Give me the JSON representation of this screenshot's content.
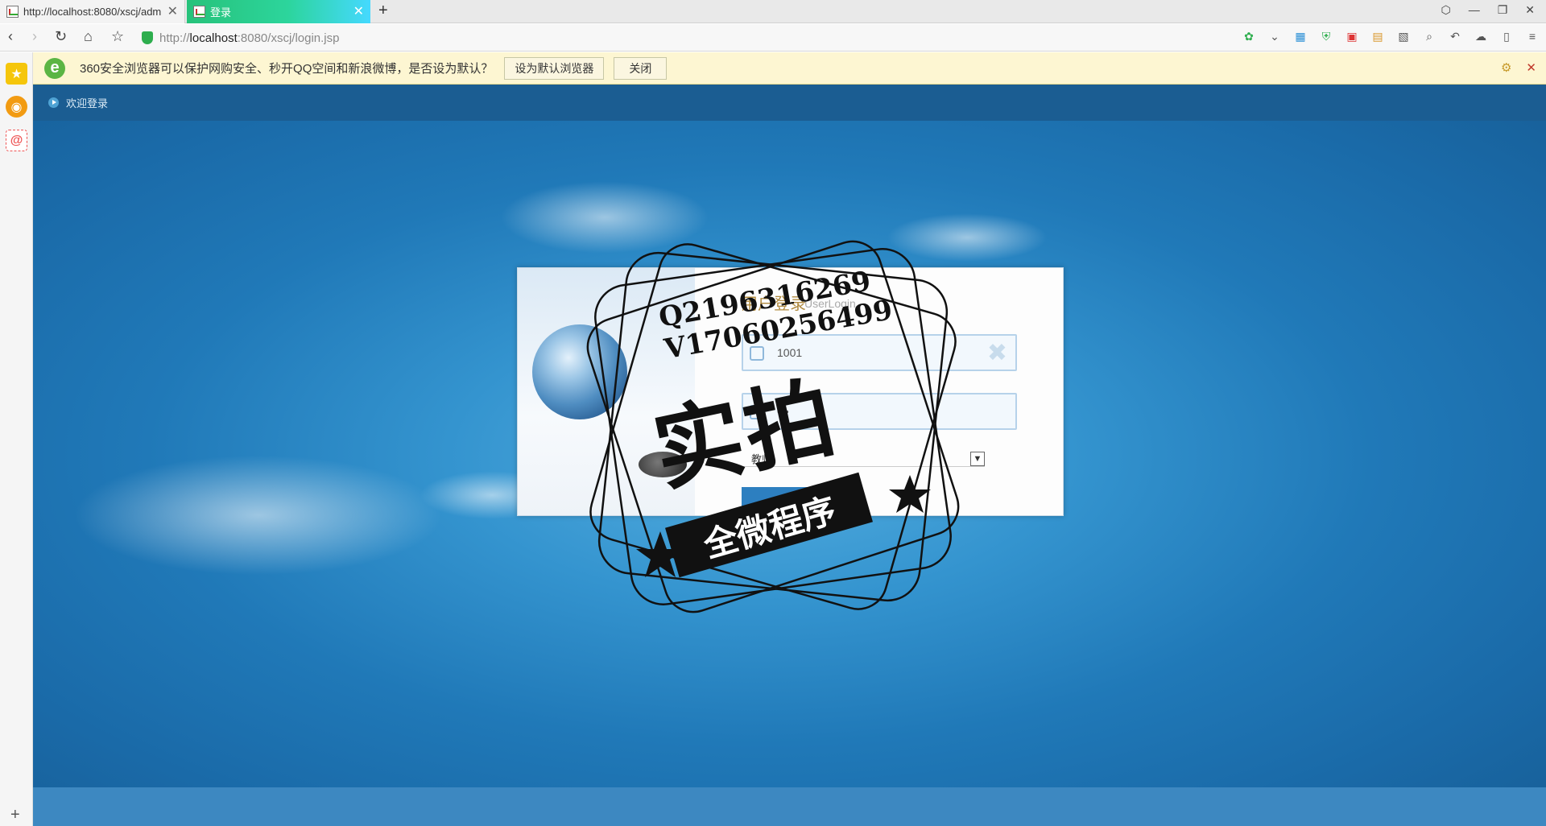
{
  "tabs": [
    {
      "label": "http://localhost:8080/xscj/adm",
      "active": false
    },
    {
      "label": "登录",
      "active": true
    }
  ],
  "address": {
    "scheme": "http://",
    "host": "localhost",
    "path": ":8080/xscj/login.jsp"
  },
  "infobar": {
    "message": "360安全浏览器可以保护网购安全、秒开QQ空间和新浪微博，是否设为默认？",
    "set_default_label": "设为默认浏览器",
    "close_label": "关闭"
  },
  "page": {
    "welcome": "欢迎登录",
    "login_title": "用户登录",
    "login_subtitle": "UserLogin",
    "username_value": "1001",
    "password_value": "•••",
    "role_value": "教师",
    "login_button": "登录"
  },
  "watermark": {
    "line1": "Q2196316269",
    "line2": "V17060256499",
    "big": "实拍",
    "band": "全微程序"
  },
  "colors": {
    "active_tab": "#2cd59c",
    "infobar_bg": "#fdf6d2",
    "page_bg": "#2079b8",
    "title_color": "#b08a3f"
  }
}
